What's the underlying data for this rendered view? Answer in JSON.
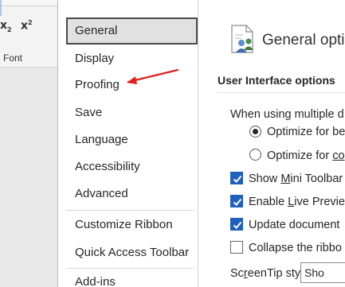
{
  "ribbon": {
    "subscript_glyph": "x",
    "subscript_mark": "2",
    "superscript_glyph": "x",
    "superscript_mark": "2",
    "font_group_label": "Font"
  },
  "nav": {
    "items": [
      {
        "label": "General",
        "selected": true
      },
      {
        "label": "Display",
        "selected": false
      },
      {
        "label": "Proofing",
        "selected": false
      },
      {
        "label": "Save",
        "selected": false
      },
      {
        "label": "Language",
        "selected": false
      },
      {
        "label": "Accessibility",
        "selected": false
      },
      {
        "label": "Advanced",
        "selected": false
      },
      {
        "label": "Customize Ribbon",
        "selected": false
      },
      {
        "label": "Quick Access Toolbar",
        "selected": false
      },
      {
        "label": "Add-ins",
        "selected": false
      }
    ]
  },
  "annotation": {
    "arrow_color": "#e02020",
    "points_to": "Proofing"
  },
  "content": {
    "header_icon": "general-options-icon",
    "page_title": "General optio",
    "section_title": "User Interface options",
    "multi_display_label": "When using multiple d",
    "radio_optimize_best": "Optimize for be",
    "radio_optimize_compat_prefix": "Optimize for ",
    "radio_optimize_compat_underlined": "co",
    "mini_toolbar_prefix": "Show ",
    "mini_toolbar_underlined": "M",
    "mini_toolbar_rest": "ini Toolbar",
    "live_preview_prefix": "Enable ",
    "live_preview_underlined": "L",
    "live_preview_rest": "ive Previe",
    "update_document": "Update document",
    "collapse_ribbon": "Collapse the ribbo",
    "screentip_prefix": "Sc",
    "screentip_underlined": "r",
    "screentip_rest": "eenTip style:",
    "screentip_value": "Sho"
  },
  "state": {
    "radio_best_selected": true,
    "mini_toolbar_checked": true,
    "live_preview_checked": true,
    "update_document_checked": true,
    "collapse_ribbon_checked": false
  },
  "colors": {
    "checkbox_accent": "#1f5fbd",
    "selected_nav_bg": "#e1e1e1"
  }
}
